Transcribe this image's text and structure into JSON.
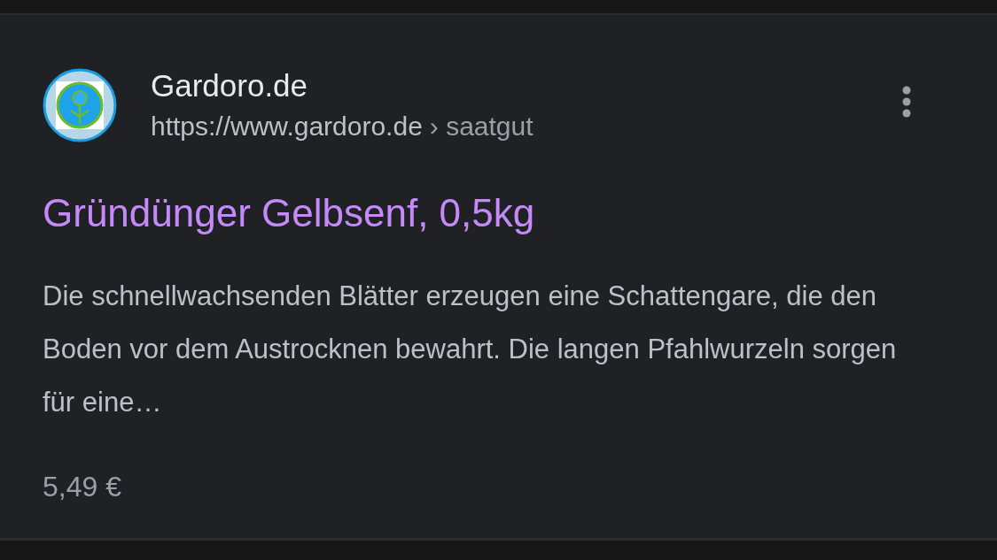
{
  "result": {
    "site_name": "Gardoro.de",
    "url": "https://www.gardoro.de",
    "breadcrumb": "› saatgut",
    "title": "Gründünger Gelbsenf, 0,5kg",
    "snippet": "Die schnellwachsenden Blätter erzeugen eine Schattengare, die den Boden vor dem Austrocknen bewahrt. Die langen Pfahlwurzeln sorgen für eine…",
    "price": "5,49 €"
  }
}
